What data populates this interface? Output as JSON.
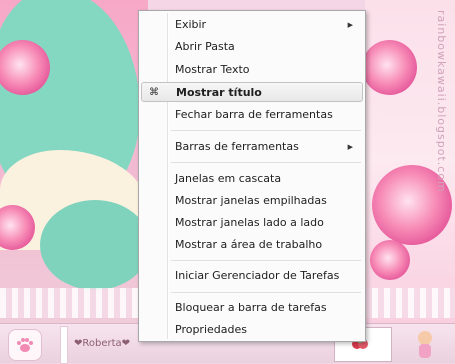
{
  "watermark": "rainbowkawaii.blogspot.com",
  "menu": {
    "items": [
      {
        "label": "Exibir",
        "submenu": true
      },
      {
        "label": "Abrir Pasta"
      },
      {
        "label": "Mostrar Texto"
      },
      {
        "label": "Mostrar título",
        "checked": true,
        "highlighted": true
      },
      {
        "label": "Fechar barra de ferramentas"
      },
      {
        "label": "Barras de ferramentas",
        "submenu": true
      },
      {
        "label": "Janelas em cascata"
      },
      {
        "label": "Mostrar janelas empilhadas"
      },
      {
        "label": "Mostrar janelas lado a lado"
      },
      {
        "label": "Mostrar a área de trabalho"
      },
      {
        "label": "Iniciar Gerenciador de Tarefas"
      },
      {
        "label": "Bloquear a barra de tarefas"
      },
      {
        "label": "Propriedades"
      }
    ]
  },
  "taskbar": {
    "task_label": "❤Roberta❤"
  },
  "colors": {
    "menu_bg": "#fbfbfb",
    "highlight": "#e8e8e8",
    "mint": "#84d8c1",
    "rose": "#e5579a"
  }
}
